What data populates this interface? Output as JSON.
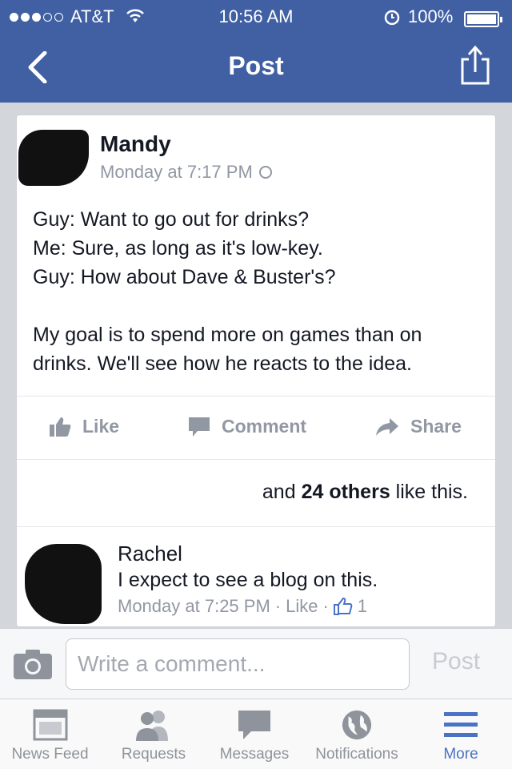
{
  "status_bar": {
    "carrier": "AT&T",
    "time": "10:56 AM",
    "battery": "100%"
  },
  "nav": {
    "title": "Post"
  },
  "post": {
    "author": "Mandy",
    "timestamp": "Monday at 7:17 PM",
    "text_lines": [
      "Guy: Want to go out for drinks?",
      "Me: Sure, as long as it's low-key.",
      "Guy: How about Dave & Buster's?",
      "",
      "My goal is to spend more on games than on",
      "drinks. We'll see how he reacts to the idea."
    ],
    "actions": {
      "like": "Like",
      "comment": "Comment",
      "share": "Share"
    },
    "likes": {
      "prefix": "and ",
      "count_text": "24 others",
      "suffix": " like this."
    }
  },
  "comment": {
    "author": "Rachel",
    "text": "I expect to see a blog on this.",
    "timestamp": "Monday at 7:25 PM",
    "like_label": "Like",
    "like_count": "1"
  },
  "composer": {
    "placeholder": "Write a comment...",
    "post_label": "Post"
  },
  "tabs": [
    {
      "label": "News Feed",
      "icon": "news-feed-icon"
    },
    {
      "label": "Requests",
      "icon": "friends-icon"
    },
    {
      "label": "Messages",
      "icon": "messages-icon"
    },
    {
      "label": "Notifications",
      "icon": "globe-icon"
    },
    {
      "label": "More",
      "icon": "menu-icon"
    }
  ],
  "colors": {
    "nav_blue": "#4060a3",
    "active_tab": "#4a73c5",
    "muted": "#9197a3"
  }
}
